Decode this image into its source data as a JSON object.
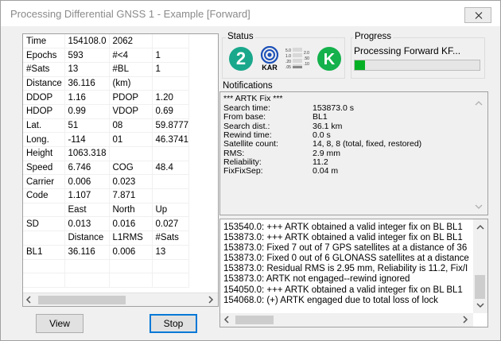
{
  "window": {
    "title": "Processing Differential GNSS 1 - Example [Forward]"
  },
  "table": {
    "rows": [
      [
        "Time",
        "154108.0",
        "2062",
        ""
      ],
      [
        "Epochs",
        "593",
        "#<4",
        "1"
      ],
      [
        "#Sats",
        "13",
        "#BL",
        "1"
      ],
      [
        "Distance",
        "36.116",
        "(km)",
        ""
      ],
      [
        "DDOP",
        "1.16",
        "PDOP",
        "1.20"
      ],
      [
        "HDOP",
        "0.99",
        "VDOP",
        "0.69"
      ],
      [
        "Lat.",
        "51",
        "08",
        "59.8777"
      ],
      [
        "Long.",
        "-114",
        "01",
        "46.3741"
      ],
      [
        "Height",
        "1063.318",
        "",
        ""
      ],
      [
        "Speed",
        "6.746",
        "COG",
        "48.4"
      ],
      [
        "Carrier",
        "0.006",
        "0.023",
        ""
      ],
      [
        "Code",
        "1.107",
        "7.871",
        ""
      ],
      [
        "",
        "East",
        "North",
        "Up"
      ],
      [
        "SD",
        "0.013",
        "0.016",
        "0.027"
      ],
      [
        "",
        "Distance",
        "L1RMS",
        "#Sats"
      ],
      [
        "BL1",
        "36.116",
        "0.006",
        "13"
      ],
      [
        "",
        "",
        "",
        ""
      ],
      [
        "",
        "",
        "",
        ""
      ]
    ]
  },
  "buttons": {
    "view": "View",
    "stop": "Stop"
  },
  "status": {
    "title": "Status",
    "solution_icon_number": "2",
    "kar_label": "KAR",
    "k_label": "K",
    "bars_labels": [
      "5.0",
      "1.0",
      ".20",
      ".05",
      "2.0",
      ".50",
      ".10"
    ]
  },
  "progress": {
    "title": "Progress",
    "label": "Processing Forward KF...",
    "fraction": 0.08
  },
  "notifications": {
    "title": "Notifications",
    "header": "*** ARTK Fix ***",
    "rows": [
      {
        "key": "Search time:",
        "value": "153873.0 s"
      },
      {
        "key": "From base:",
        "value": "BL1"
      },
      {
        "key": "Search dist.:",
        "value": "36.1 km"
      },
      {
        "key": "Rewind time:",
        "value": "0.0 s"
      },
      {
        "key": "Satellite count:",
        "value": "14, 8, 8  (total, fixed, restored)"
      },
      {
        "key": "RMS:",
        "value": "2.9 mm"
      },
      {
        "key": "Reliability:",
        "value": "11.2"
      },
      {
        "key": "FixFixSep:",
        "value": "0.04 m"
      }
    ]
  },
  "log": [
    "153540.0: +++ ARTK obtained a valid integer fix on BL BL1",
    "153873.0: +++ ARTK obtained a valid integer fix on BL BL1",
    "153873.0:   Fixed 7 out of 7 GPS satellites at a distance of 36",
    "153873.0:   Fixed 0 out of 6 GLONASS satellites at a distance",
    "153873.0:   Residual RMS is 2.95 mm, Reliability is 11.2, Fix/I",
    "153873.0:   ARTK not engaged--rewind ignored",
    "154050.0: +++ ARTK obtained a valid integer fix on BL BL1",
    "154068.0: (+) ARTK engaged due to total loss of lock"
  ],
  "colors": {
    "solution_green": "#1aa88c",
    "kar_blue": "#1c50b8",
    "k_green": "#14b14c",
    "progress_green": "#06b025",
    "accent_border": "#0078d7"
  }
}
